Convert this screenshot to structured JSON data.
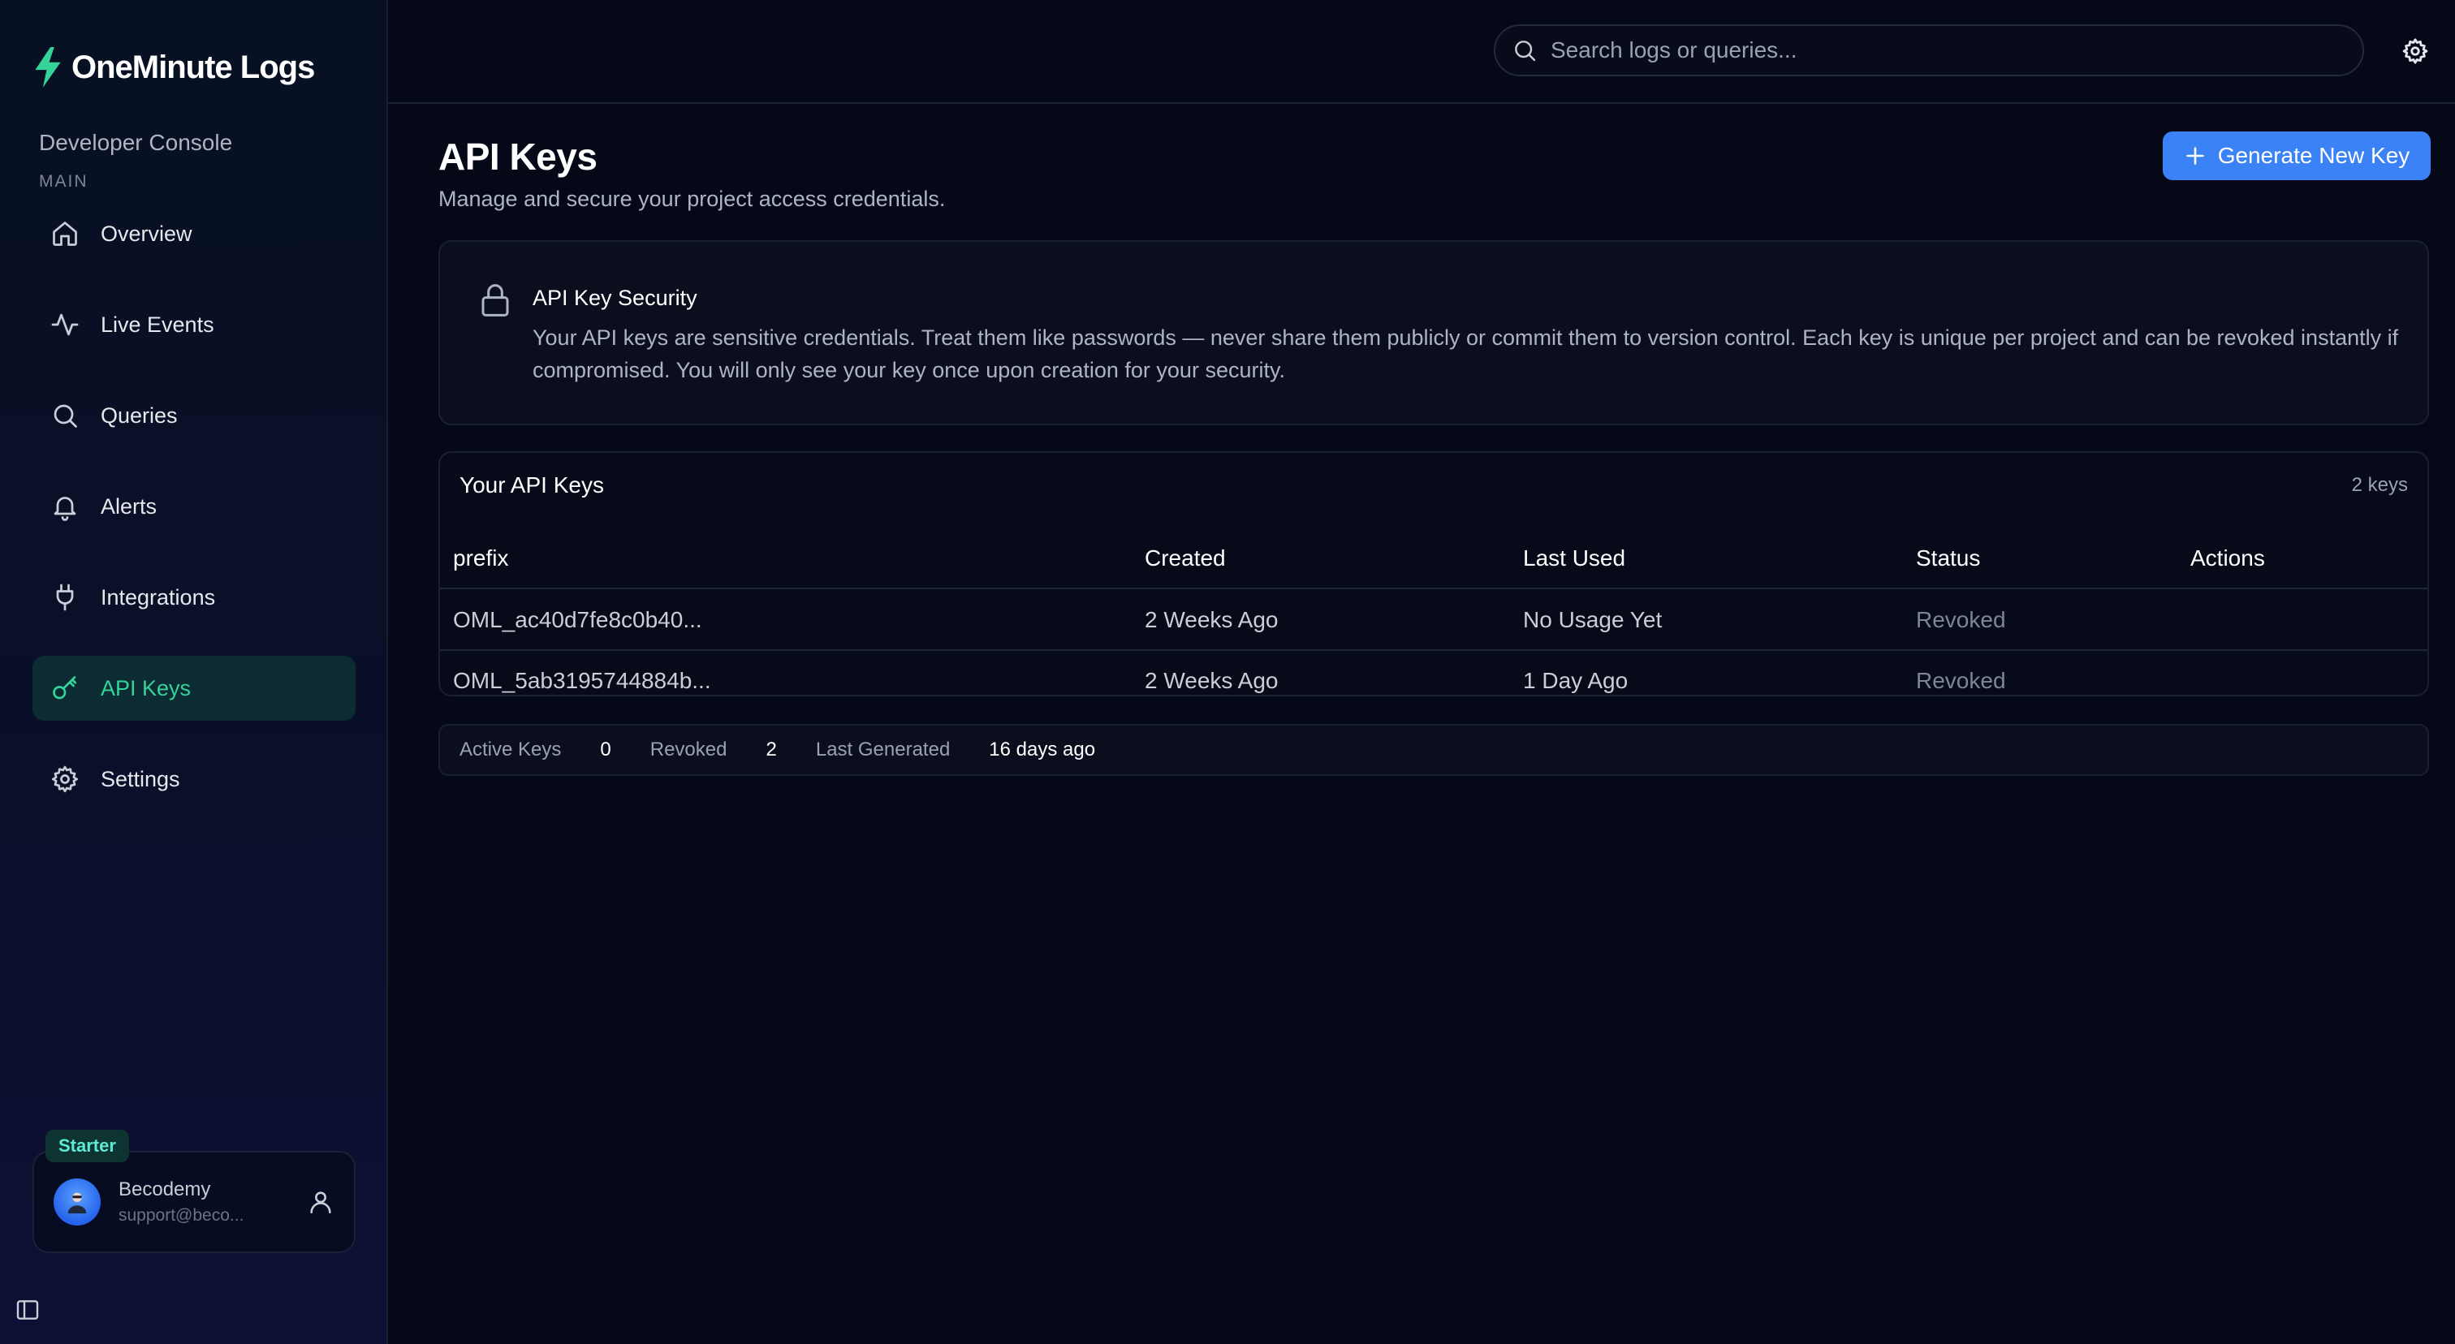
{
  "brand": {
    "name": "OneMinute Logs",
    "accent": "#34d399"
  },
  "sidebar": {
    "console_title": "Developer Console",
    "section_label": "MAIN",
    "items": [
      {
        "label": "Overview",
        "icon": "home-icon"
      },
      {
        "label": "Live Events",
        "icon": "activity-icon"
      },
      {
        "label": "Queries",
        "icon": "search-icon"
      },
      {
        "label": "Alerts",
        "icon": "bell-icon"
      },
      {
        "label": "Integrations",
        "icon": "plug-icon"
      },
      {
        "label": "API Keys",
        "icon": "key-icon",
        "active": true
      },
      {
        "label": "Settings",
        "icon": "gear-icon"
      }
    ],
    "plan": "Starter",
    "user": {
      "name": "Becodemy",
      "email": "support@beco..."
    }
  },
  "topbar": {
    "search_placeholder": "Search logs or queries..."
  },
  "page": {
    "title": "API Keys",
    "subtitle": "Manage and secure your project access credentials.",
    "generate_button": "Generate New Key"
  },
  "security": {
    "title": "API Key Security",
    "body": "Your API keys are sensitive credentials. Treat them like passwords — never share them publicly or commit them to version control. Each key is unique per project and can be revoked instantly if compromised. You will only see your key once upon creation for your security."
  },
  "keys": {
    "title": "Your API Keys",
    "count_label": "2 keys",
    "columns": [
      "prefix",
      "Created",
      "Last Used",
      "Status",
      "Actions"
    ],
    "rows": [
      {
        "prefix": "OML_ac40d7fe8c0b40...",
        "created": "2 Weeks Ago",
        "last_used": "No Usage Yet",
        "status": "Revoked",
        "actions": ""
      },
      {
        "prefix": "OML_5ab3195744884b...",
        "created": "2 Weeks Ago",
        "last_used": "1 Day Ago",
        "status": "Revoked",
        "actions": ""
      }
    ]
  },
  "stats": [
    {
      "label": "Active Keys",
      "value": "0"
    },
    {
      "label": "Revoked",
      "value": "2"
    },
    {
      "label": "Last Generated",
      "value": "16 days ago"
    }
  ],
  "colors": {
    "primary_button": "#3b82f6",
    "active_nav_bg": "#0c2b33",
    "background": "#050816"
  }
}
